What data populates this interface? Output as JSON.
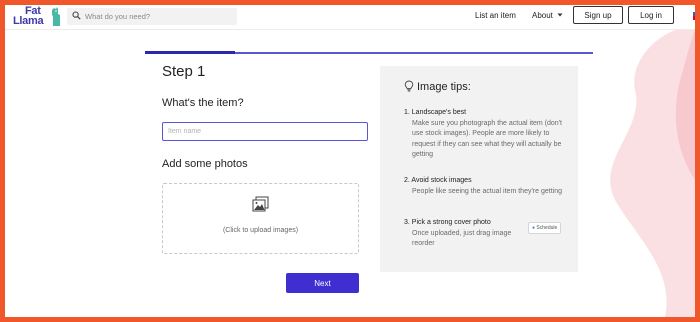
{
  "header": {
    "logo_line1": "Fat",
    "logo_line2": "Llama",
    "search_placeholder": "What do you need?",
    "nav_list_item": "List an item",
    "nav_about": "About",
    "signup_label": "Sign up",
    "login_label": "Log in"
  },
  "progress": {
    "current_step": 1,
    "fraction_complete": 0.2
  },
  "form": {
    "step_title": "Step 1",
    "item_question": "What's the item?",
    "item_placeholder": "Item name",
    "photos_heading": "Add some photos",
    "upload_text": "(Click to upload images)",
    "next_label": "Next"
  },
  "tips": {
    "title": "Image tips:",
    "items": [
      {
        "heading": "1. Landscape's best",
        "body": "Make sure you photograph the actual item (don't use stock images). People are more likely to request if they can see what they will actually be getting"
      },
      {
        "heading": "2. Avoid stock images",
        "body": "People like seeing the actual item they're getting"
      },
      {
        "heading": "3. Pick a strong cover photo",
        "body": "Once uploaded, just drag image reorder"
      }
    ],
    "schedule_badge": "Schedule"
  },
  "colors": {
    "accent": "#3f2fd0",
    "frame": "#f0572a",
    "brand": "#3c3aa8",
    "pink_decor": "#f7c9cf"
  }
}
